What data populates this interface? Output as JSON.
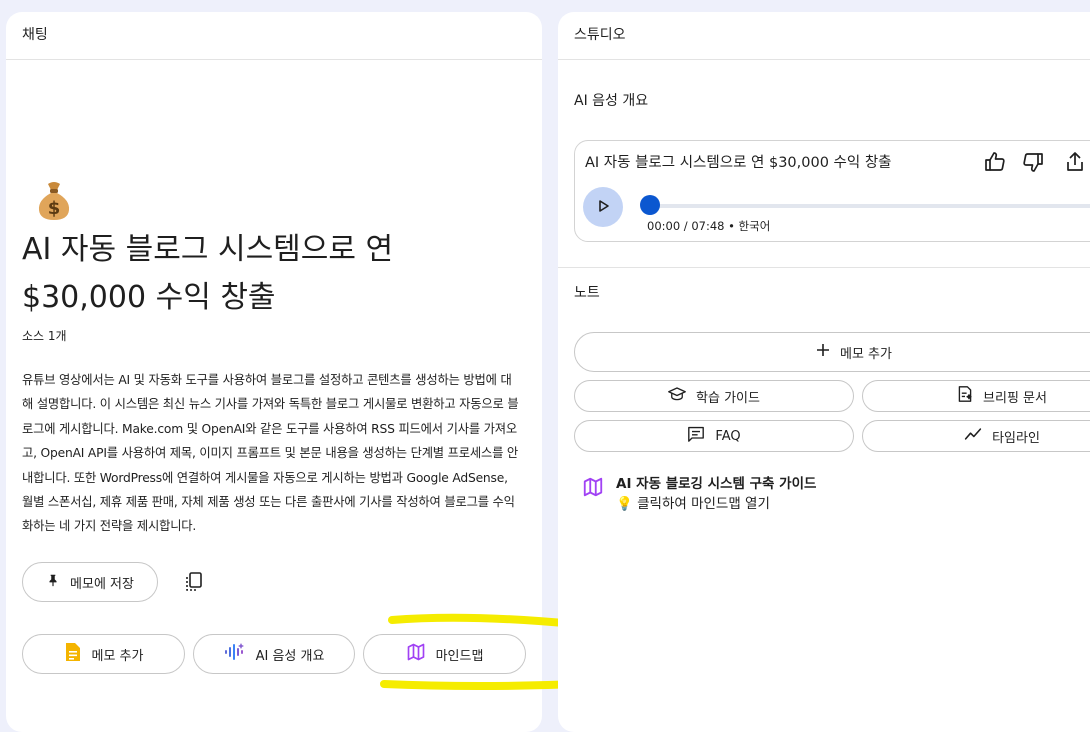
{
  "chat": {
    "header": "채팅",
    "emoji": "💰",
    "title": "AI 자동 블로그 시스템으로 연 $30,000 수익 창출",
    "source_count": "소스 1개",
    "summary": "유튜브 영상에서는 AI 및 자동화 도구를 사용하여 블로그를 설정하고 콘텐츠를 생성하는 방법에 대해 설명합니다. 이 시스템은 최신 뉴스 기사를 가져와 독특한 블로그 게시물로 변환하고 자동으로 블로그에 게시합니다. Make.com 및 OpenAI와 같은 도구를 사용하여 RSS 피드에서 기사를 가져오고, OpenAI API를 사용하여 제목, 이미지 프롬프트 및 본문 내용을 생성하는 단계별 프로세스를 안내합니다. 또한 WordPress에 연결하여 게시물을 자동으로 게시하는 방법과 Google AdSense, 월별 스폰서십, 제휴 제품 판매, 자체 제품 생성 또는 다른 출판사에 기사를 작성하여 블로그를 수익화하는 네 가지 전략을 제시합니다.",
    "save_memo_label": "메모에 저장",
    "actions": {
      "add_memo": "메모 추가",
      "audio_overview": "AI 음성 개요",
      "mindmap": "마인드맵"
    }
  },
  "studio": {
    "header": "스튜디오",
    "audio_section_title": "AI 음성 개요",
    "audio": {
      "title": "AI 자동 블로그 시스템으로 연 $30,000 수익 창출",
      "time": "00:00 / 07:48 • 한국어",
      "progress": 0
    },
    "notes_title": "노트",
    "add_note_label": "메모 추가",
    "buttons": {
      "study_guide": "학습 가이드",
      "briefing": "브리핑 문서",
      "faq": "FAQ",
      "timeline": "타임라인"
    },
    "mindmap_note": {
      "title": "AI 자동 블로깅 시스템 구축 가이드",
      "hint": "클릭하여 마인드맵 열기"
    }
  },
  "colors": {
    "accent_blue": "#0b57d0",
    "play_bg": "#c2d3f5",
    "highlight_yellow": "#f5ec00",
    "mindmap_purple": "#a142f4",
    "memo_yellow": "#f4b400"
  }
}
